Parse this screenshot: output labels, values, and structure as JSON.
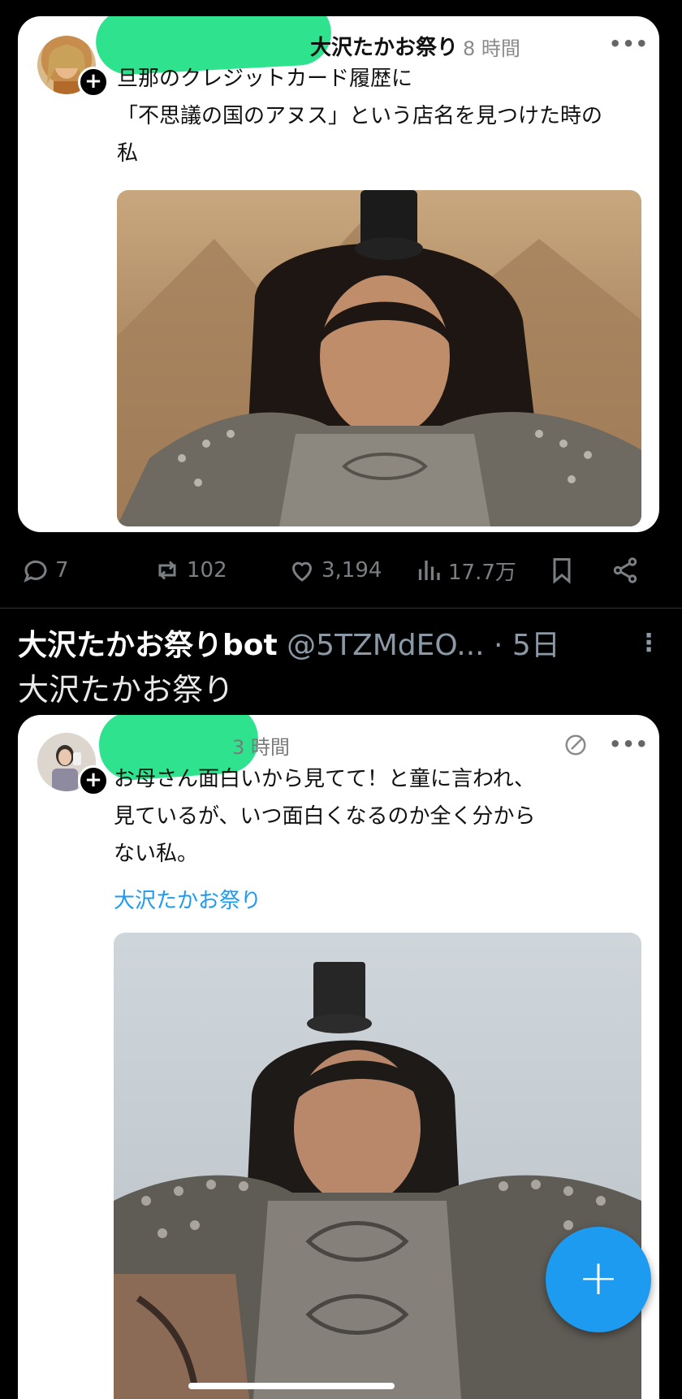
{
  "post1": {
    "name": "大沢たかお祭り",
    "time": "8 時間",
    "more": "•••",
    "follow": "+",
    "text_lines": [
      "旦那のクレジットカード履歴に",
      "「不思議の国のアヌス」という店名を見つけた時の",
      "私"
    ],
    "media_desc": "armored-general-photo"
  },
  "actions": {
    "replies": "7",
    "reposts": "102",
    "likes": "3,194",
    "views": "17.7万"
  },
  "bot": {
    "name": "大沢たかお祭りbot",
    "handle": "@5TZMdEO...",
    "time": "· 5日",
    "more": "⋮",
    "text": "大沢たかお祭り"
  },
  "post2": {
    "time": "3 時間",
    "more": "•••",
    "follow": "+",
    "text_lines": [
      "お母さん面白いから見てて！と童に言われ、",
      "見ているが、いつ面白くなるのか全く分から",
      "ない私。"
    ],
    "link": "大沢たかお祭り",
    "media_desc": "armored-general-photo"
  },
  "fab_label": "+",
  "colors": {
    "accent": "#1d9bf0",
    "redaction": "#2fe38e"
  }
}
